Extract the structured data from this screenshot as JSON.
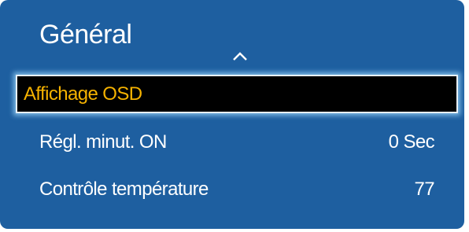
{
  "menu": {
    "title": "Général",
    "items": [
      {
        "label": "Affichage OSD",
        "value": "",
        "selected": true
      },
      {
        "label": "Régl. minut. ON",
        "value": "0 Sec",
        "selected": false
      },
      {
        "label": "Contrôle température",
        "value": "77",
        "selected": false
      }
    ],
    "scroll_indicator_icon": "chevron-up-icon"
  },
  "colors": {
    "panel_background": "#1e5fa0",
    "selected_background": "#000000",
    "selected_text": "#f5b200",
    "selected_glow": "#8cc8f0",
    "text": "#ffffff"
  }
}
